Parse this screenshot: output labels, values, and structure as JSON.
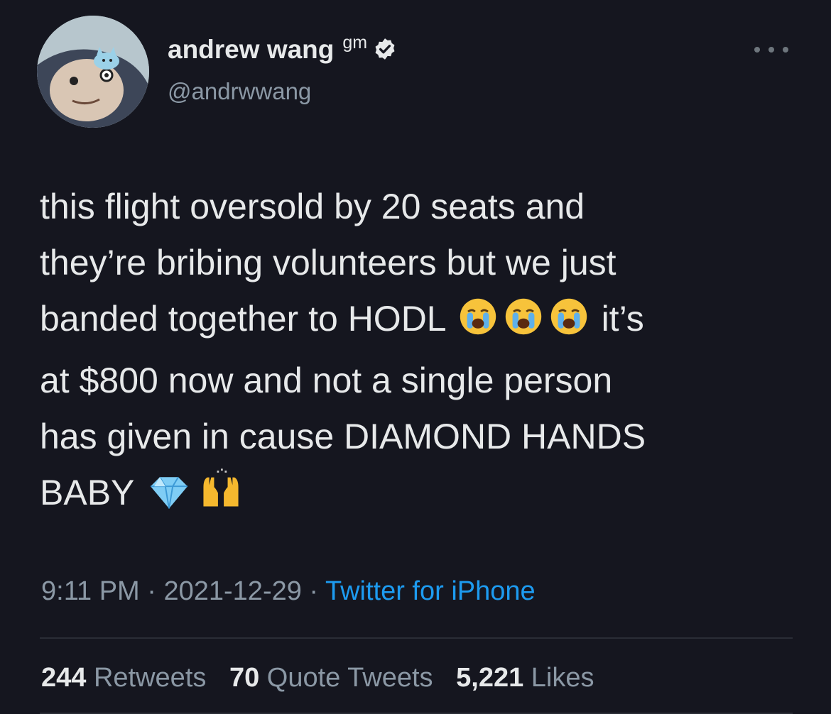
{
  "author": {
    "display_name": "andrew wang",
    "name_suffix": "gm",
    "handle": "@andrwwang",
    "verified_icon": "verified-badge-icon"
  },
  "tweet": {
    "lines": [
      "this flight oversold by 20 seats and",
      "they’re bribing volunteers but we just",
      "banded together to HODL",
      "it’s",
      "at $800 now and not a single person",
      "has given in cause DIAMOND HANDS",
      "BABY"
    ],
    "emojis": [
      "loudly-crying-face",
      "loudly-crying-face",
      "loudly-crying-face",
      "gem-stone",
      "raising-hands"
    ]
  },
  "meta": {
    "time": "9:11 PM",
    "separator": " · ",
    "date": "2021-12-29",
    "source": "Twitter for iPhone"
  },
  "stats": {
    "retweets_count": "244",
    "retweets_label": "Retweets",
    "quotes_count": "70",
    "quotes_label": "Quote Tweets",
    "likes_count": "5,221",
    "likes_label": "Likes"
  },
  "colors": {
    "background": "#15161f",
    "text": "#e7e9ea",
    "muted": "#8b98a5",
    "link": "#1d9bf0"
  }
}
